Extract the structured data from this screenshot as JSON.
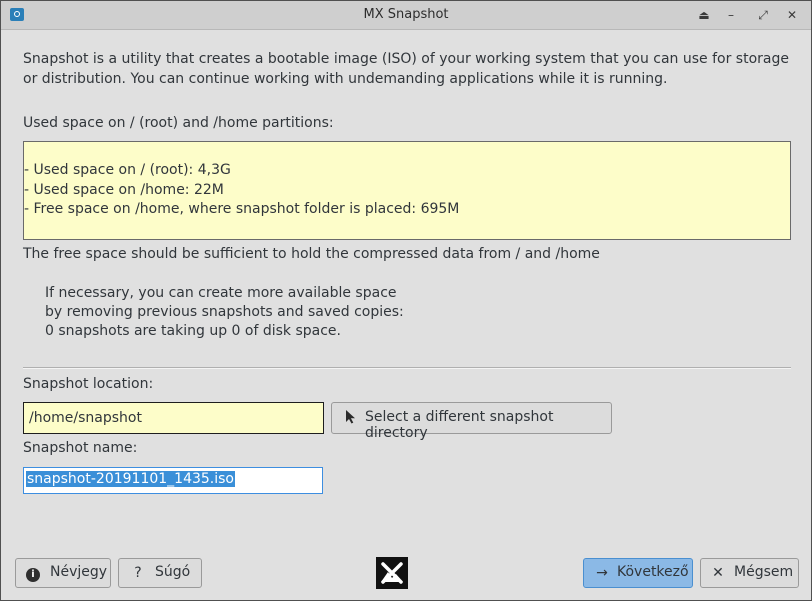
{
  "window": {
    "title": "MX Snapshot",
    "controls": {
      "keep_above_glyph": "⏏",
      "minimize_glyph": "–",
      "maximize_glyph": "⤢",
      "close_glyph": "✕"
    }
  },
  "intro_text": "Snapshot is a utility that creates a bootable image (ISO) of your working system that you can use for storage or distribution. You can continue working with undemanding applications while it is running.",
  "usage": {
    "label": "Used space on / (root) and /home partitions:",
    "lines": [
      "- Used space on / (root): 4,3G",
      "- Used space on /home: 22M",
      "- Free space on /home, where snapshot folder is placed: 695M"
    ],
    "background_color": "#fdfdc9"
  },
  "free_space_note": "The free space should be sufficient to hold the compressed data from / and /home",
  "hint_lines": [
    "If necessary, you can create more available space",
    "by removing previous snapshots and saved copies:",
    "0 snapshots are taking up 0 of disk space."
  ],
  "location": {
    "label": "Snapshot location:",
    "value": "/home/snapshot",
    "button_label": "Select a different snapshot directory",
    "button_icon": "cursor-arrow-icon"
  },
  "name": {
    "label": "Snapshot name:",
    "value": "snapshot-20191101_1435.iso",
    "selected": true
  },
  "footer": {
    "about_label": "Névjegy",
    "about_glyph": "i",
    "help_label": "Súgó",
    "help_glyph": "?",
    "next_label": "Következő",
    "next_glyph": "→",
    "cancel_label": "Mégsem",
    "cancel_glyph": "✕",
    "logo_icon": "mx-logo-icon"
  },
  "colors": {
    "window_bg": "#e0e0e0",
    "accent": "#3a8fd8",
    "next_button_bg": "#8bb9e6",
    "input_highlight": "#fdfdc9"
  }
}
